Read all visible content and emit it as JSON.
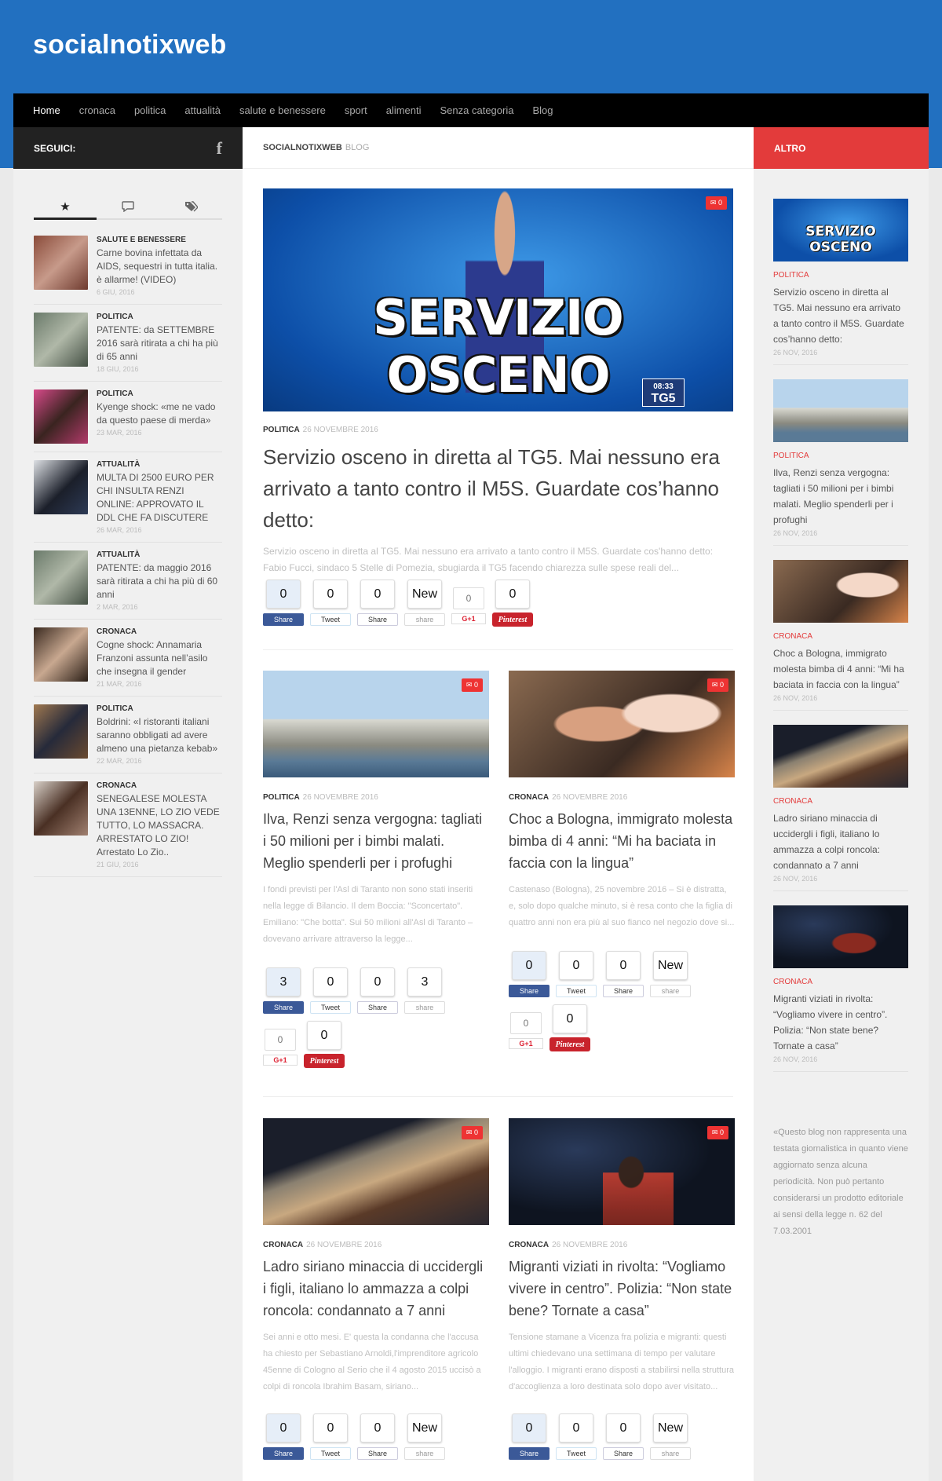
{
  "site": {
    "title": "socialnotixweb"
  },
  "nav": [
    "Home",
    "cronaca",
    "politica",
    "attualità",
    "salute e benessere",
    "sport",
    "alimenti",
    "Senza categoria",
    "Blog"
  ],
  "left": {
    "follow_label": "SEGUICI:",
    "items": [
      {
        "cat": "SALUTE E BENESSERE",
        "title": "Carne bovina infettata da AIDS, sequestri in tutta italia. è allarme! (VIDEO)",
        "date": "6 GIU, 2016"
      },
      {
        "cat": "POLITICA",
        "title": "PATENTE: da SETTEMBRE 2016 sarà ritirata a chi ha più di 65 anni",
        "date": "18 GIU, 2016"
      },
      {
        "cat": "POLITICA",
        "title": "Kyenge shock: «me ne vado da questo paese di merda»",
        "date": "23 MAR, 2016"
      },
      {
        "cat": "ATTUALITÀ",
        "title": "MULTA DI 2500 EURO PER CHI INSULTA RENZI ONLINE: APPROVATO IL DDL CHE FA DISCUTERE",
        "date": "26 MAR, 2016"
      },
      {
        "cat": "ATTUALITÀ",
        "title": "PATENTE: da maggio 2016 sarà ritirata a chi ha più di 60 anni",
        "date": "2 MAR, 2016"
      },
      {
        "cat": "CRONACA",
        "title": "Cogne shock: Annamaria Franzoni assunta nell’asilo che insegna il gender",
        "date": "21 MAR, 2016"
      },
      {
        "cat": "POLITICA",
        "title": "Boldrini: «I ristoranti italiani saranno obbligati ad avere almeno una pietanza kebab»",
        "date": "22 MAR, 2016"
      },
      {
        "cat": "CRONACA",
        "title": "SENEGALESE MOLESTA UNA 13ENNE, LO ZIO VEDE TUTTO, LO MASSACRA. ARRESTATO LO ZIO! Arrestato Lo Zio..",
        "date": "21 GIU, 2016"
      }
    ]
  },
  "main": {
    "heading": "SOCIALNOTIXWEB",
    "heading_light": "BLOG",
    "featured": {
      "image_text": "SERVIZIO OSCENO",
      "clock": "08:33",
      "channel": "TG5",
      "badge": "0",
      "cat": "POLITICA",
      "date": "26 NOVEMBRE 2016",
      "title": "Servizio osceno in diretta al TG5. Mai nessuno era arrivato a tanto contro il M5S. Guardate cos’hanno detto:",
      "excerpt": "Servizio osceno in diretta al TG5. Mai nessuno era arrivato a tanto contro il M5S. Guardate cos'hanno detto: Fabio Fucci, sindaco 5 Stelle di Pomezia, sbugiarda il TG5 facendo chiarezza sulle spese reali del...",
      "counts": [
        "0",
        "0",
        "0",
        "New"
      ],
      "gcount": "0",
      "pcount": "0"
    },
    "cards": [
      {
        "badge": "0",
        "cat": "POLITICA",
        "date": "26 NOVEMBRE 2016",
        "title": "Ilva, Renzi senza vergogna: tagliati i 50 milioni per i bimbi malati. Meglio spenderli per i profughi",
        "excerpt": "I fondi previsti per l'Asl di Taranto non sono stati inseriti nella legge di Bilancio. Il dem Boccia: \"Sconcertato\". Emiliano: \"Che botta\". Sui 50 milioni all'Asl di Taranto – dovevano arrivare attraverso la legge...",
        "counts": [
          "3",
          "0",
          "0",
          "3"
        ],
        "gcount": "0",
        "pcount": "0"
      },
      {
        "badge": "0",
        "cat": "CRONACA",
        "date": "26 NOVEMBRE 2016",
        "title": "Choc a Bologna, immigrato molesta bimba di 4 anni: “Mi ha baciata in faccia con la lingua”",
        "excerpt": "Castenaso (Bologna), 25 novembre 2016 – Si è distratta, e, solo dopo qualche minuto, si è resa conto che la figlia di quattro anni non era più al suo fianco nel negozio dove si...",
        "counts": [
          "0",
          "0",
          "0",
          "New"
        ],
        "gcount": "0",
        "pcount": "0"
      },
      {
        "badge": "0",
        "cat": "CRONACA",
        "date": "26 NOVEMBRE 2016",
        "title": "Ladro siriano minaccia di uccidergli i figli, italiano lo ammazza a colpi roncola: condannato a 7 anni",
        "excerpt": "Sei anni e otto mesi. E' questa la condanna che l'accusa ha chiesto per Sebastiano Arnoldi,l'imprenditore agricolo 45enne di Cologno al Serio che il 4 agosto 2015 uccisò a colpi di roncola Ibrahim Basam, siriano...",
        "counts": [
          "0",
          "0",
          "0",
          "New"
        ]
      },
      {
        "badge": "0",
        "cat": "CRONACA",
        "date": "26 NOVEMBRE 2016",
        "title": "Migranti viziati in rivolta: “Vogliamo vivere in centro”. Polizia: “Non state bene? Tornate a casa”",
        "excerpt": "Tensione stamane a Vicenza fra polizia e migranti: questi ultimi chiedevano una settimana di tempo per valutare l'alloggio. I migranti erano disposti a stabilirsi nella struttura d'accoglienza a loro destinata solo dopo aver visitato...",
        "counts": [
          "0",
          "0",
          "0",
          "New"
        ]
      }
    ],
    "share_labels": [
      "Share",
      "Tweet",
      "Share",
      "share"
    ],
    "g_label": "G+1",
    "p_label": "Pinterest"
  },
  "right": {
    "heading": "ALTRO",
    "items": [
      {
        "img_text": "SERVIZIO OSCENO",
        "cat": "POLITICA",
        "title": "Servizio osceno in diretta al TG5. Mai nessuno era arrivato a tanto contro il M5S. Guardate cos’hanno detto:",
        "date": "26 NOV, 2016"
      },
      {
        "cat": "POLITICA",
        "title": "Ilva, Renzi senza vergogna: tagliati i 50 milioni per i bimbi malati. Meglio spenderli per i profughi",
        "date": "26 NOV, 2016"
      },
      {
        "cat": "CRONACA",
        "title": "Choc a Bologna, immigrato molesta bimba di 4 anni: “Mi ha baciata in faccia con la lingua”",
        "date": "26 NOV, 2016"
      },
      {
        "cat": "CRONACA",
        "title": "Ladro siriano minaccia di uccidergli i figli, italiano lo ammazza a colpi roncola: condannato a 7 anni",
        "date": "26 NOV, 2016"
      },
      {
        "cat": "CRONACA",
        "title": "Migranti viziati in rivolta: “Vogliamo vivere in centro”. Polizia: “Non state bene? Tornate a casa”",
        "date": "26 NOV, 2016"
      }
    ],
    "note": "«Questo blog non rappresenta una testata giornalistica in quanto viene aggiornato senza alcuna periodicità. Non può pertanto considerarsi un prodotto editoriale ai sensi della legge n. 62 del 7.03.2001"
  }
}
